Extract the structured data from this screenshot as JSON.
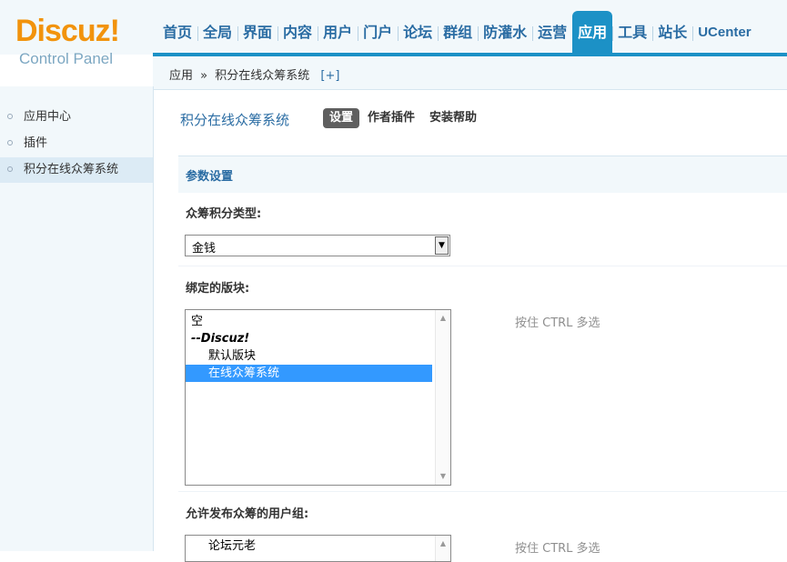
{
  "logo": {
    "brand": "Discuz!",
    "subtitle": "Control Panel"
  },
  "nav": {
    "items": [
      {
        "label": "首页"
      },
      {
        "label": "全局"
      },
      {
        "label": "界面"
      },
      {
        "label": "内容"
      },
      {
        "label": "用户"
      },
      {
        "label": "门户"
      },
      {
        "label": "论坛"
      },
      {
        "label": "群组"
      },
      {
        "label": "防灌水"
      },
      {
        "label": "运营"
      },
      {
        "label": "应用",
        "active": true
      },
      {
        "label": "工具"
      },
      {
        "label": "站长"
      },
      {
        "label": "UCenter"
      }
    ]
  },
  "breadcrumb": {
    "root": "应用",
    "sep": "»",
    "current": "积分在线众筹系统",
    "add": "[+]"
  },
  "sidebar": {
    "items": [
      {
        "label": "应用中心"
      },
      {
        "label": "插件"
      },
      {
        "label": "积分在线众筹系统",
        "active": true
      }
    ]
  },
  "main": {
    "title": "积分在线众筹系统",
    "tabs": [
      {
        "label": "设置",
        "active": true
      },
      {
        "label": "作者插件"
      },
      {
        "label": "安装帮助"
      }
    ],
    "section": "参数设置",
    "credit_label": "众筹积分类型:",
    "credit_value": "金钱",
    "forums_label": "绑定的版块:",
    "forums_options": [
      {
        "label": "空",
        "type": "plain"
      },
      {
        "label": "--Discuz!",
        "type": "group"
      },
      {
        "label": "默认版块",
        "type": "indent"
      },
      {
        "label": "在线众筹系统",
        "type": "indent",
        "selected": true
      }
    ],
    "forums_hint": "按住 CTRL 多选",
    "groups_label": "允许发布众筹的用户组:",
    "groups_options": [
      {
        "label": "论坛元老",
        "type": "indent"
      }
    ],
    "groups_hint": "按住 CTRL 多选"
  }
}
